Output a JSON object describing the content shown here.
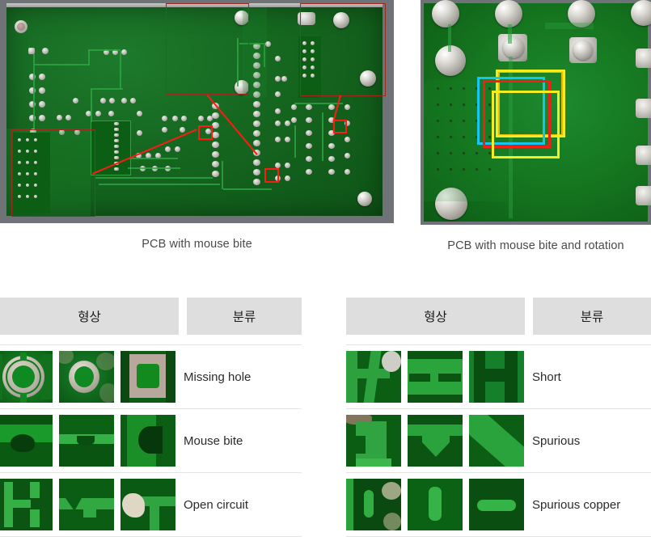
{
  "figures": [
    {
      "id": "pcb-mouse-bite",
      "caption": "PCB with mouse bite",
      "alt": "Green printed circuit board photograph with red annotation rectangles marking mouse bite defects and zoomed crop overlays"
    },
    {
      "id": "pcb-mouse-bite-rotation",
      "caption": "PCB with mouse bite and rotation",
      "alt": "Close-up of green printed circuit board with overlapping cyan, red, yellow and orange bounding boxes showing rotated detections"
    }
  ],
  "tables": [
    {
      "id": "defect-table-left",
      "headers": {
        "shape": "형상",
        "classification": "분류"
      },
      "rows": [
        {
          "classification": "Missing hole",
          "thumbnails": [
            "missing-hole-1",
            "missing-hole-2",
            "missing-hole-3"
          ]
        },
        {
          "classification": "Mouse bite",
          "thumbnails": [
            "mouse-bite-1",
            "mouse-bite-2",
            "mouse-bite-3"
          ]
        },
        {
          "classification": "Open circuit",
          "thumbnails": [
            "open-circuit-1",
            "open-circuit-2",
            "open-circuit-3"
          ]
        }
      ]
    },
    {
      "id": "defect-table-right",
      "headers": {
        "shape": "형상",
        "classification": "분류"
      },
      "rows": [
        {
          "classification": "Short",
          "thumbnails": [
            "short-1",
            "short-2",
            "short-3"
          ]
        },
        {
          "classification": "Spurious",
          "thumbnails": [
            "spurious-1",
            "spurious-2",
            "spurious-3"
          ]
        },
        {
          "classification": "Spurious copper",
          "thumbnails": [
            "spurious-copper-1",
            "spurious-copper-2",
            "spurious-copper-3"
          ]
        }
      ]
    }
  ],
  "colors": {
    "page_background": "#ffffff",
    "header_cell_background": "#dedede",
    "header_text": "#1c1c1c",
    "body_text": "#2b2b2b",
    "caption_text": "#4a4a4a",
    "row_divider": "#e3e3e3",
    "pcb_green": "#157a22",
    "annotation_red": "#ff1a12",
    "bbox_cyan": "#14c6f0",
    "bbox_red": "#f21f18",
    "bbox_yellow": "#f5ec1d",
    "bbox_orange": "#e8b90f",
    "pcb_frame_gray": "#6f7276"
  }
}
